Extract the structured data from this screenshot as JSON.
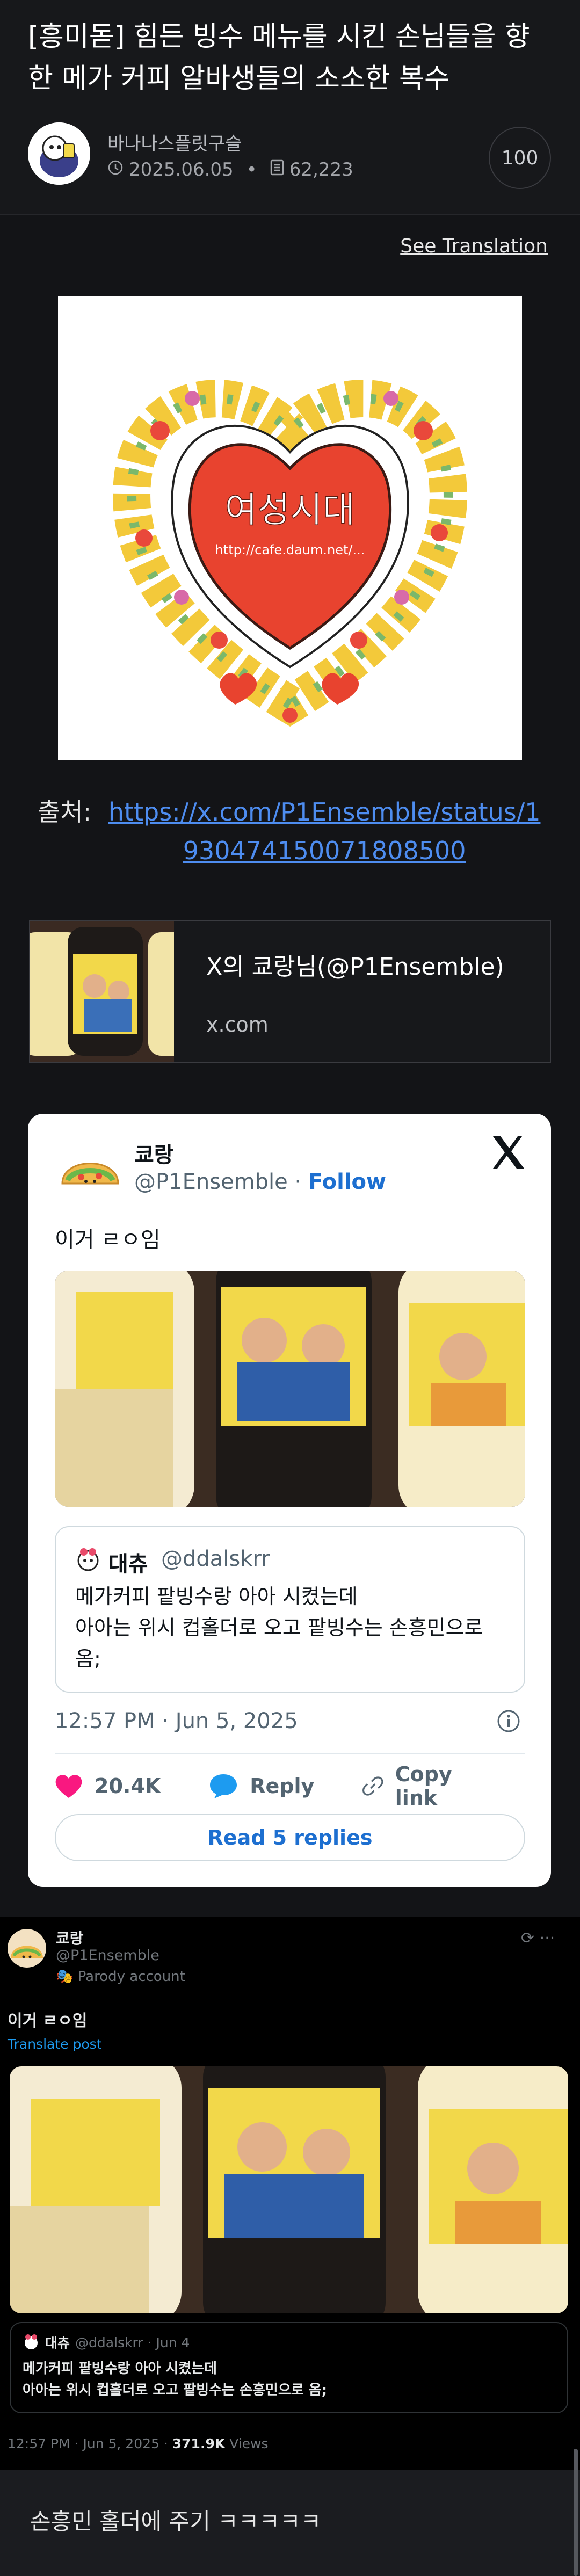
{
  "post": {
    "title": "[흥미돋] 힘든 빙수 메뉴를 시킨 손님들을 향한 메가 커피 알바생들의 소소한 복수",
    "author": "바나나스플릿구슬",
    "date": "2025.06.05",
    "views": "62,223",
    "comment_count": "100",
    "translate_label": "See Translation"
  },
  "main_image": {
    "heart_text": "여성시대",
    "heart_subtext": "http://cafe.daum.net/..."
  },
  "source": {
    "label": "출처:",
    "url": "https://x.com/P1Ensemble/status/1930474150071808500"
  },
  "link_card": {
    "title": "X의 쿄랑님(@P1Ensemble)",
    "domain": "x.com"
  },
  "tweet": {
    "name": "쿄랑",
    "handle": "@P1Ensemble",
    "follow_label": "Follow",
    "text": "이거 ㄹㅇ임",
    "quote": {
      "name": "대츄",
      "handle": "@ddalskrr",
      "lines": [
        "메가커피 팥빙수랑 아아 시켰는데",
        "아아는 위시 컵홀더로 오고 팥빙수는 손흥민으로",
        "옴;"
      ]
    },
    "timestamp": "12:57 PM · Jun 5, 2025",
    "likes": "20.4K",
    "reply_label": "Reply",
    "copy_label": "Copy link",
    "read_replies": "Read 5 replies"
  },
  "screenshot": {
    "name": "쿄랑",
    "handle": "@P1Ensemble",
    "parody": "Parody account",
    "text": "이거 ㄹㅇ임",
    "translate": "Translate post",
    "quote_name": "대츄",
    "quote_meta": "@ddalskrr · Jun 4",
    "quote_line1": "메가커피 팥빙수랑 아아 시켰는데",
    "quote_line2": "아아는 위시 컵홀더로 오고 팥빙수는 손흥민으로 옴;",
    "footer_time": "12:57 PM · Jun 5, 2025 · ",
    "footer_views": "371.9K",
    "footer_views_label": " Views"
  },
  "comment": {
    "text": "손흥민 홀더에 주기 ㅋㅋㅋㅋㅋ"
  },
  "colors": {
    "link_blue": "#4e8df0",
    "x_blue": "#1d6fd0",
    "like_pink": "#f91880"
  }
}
